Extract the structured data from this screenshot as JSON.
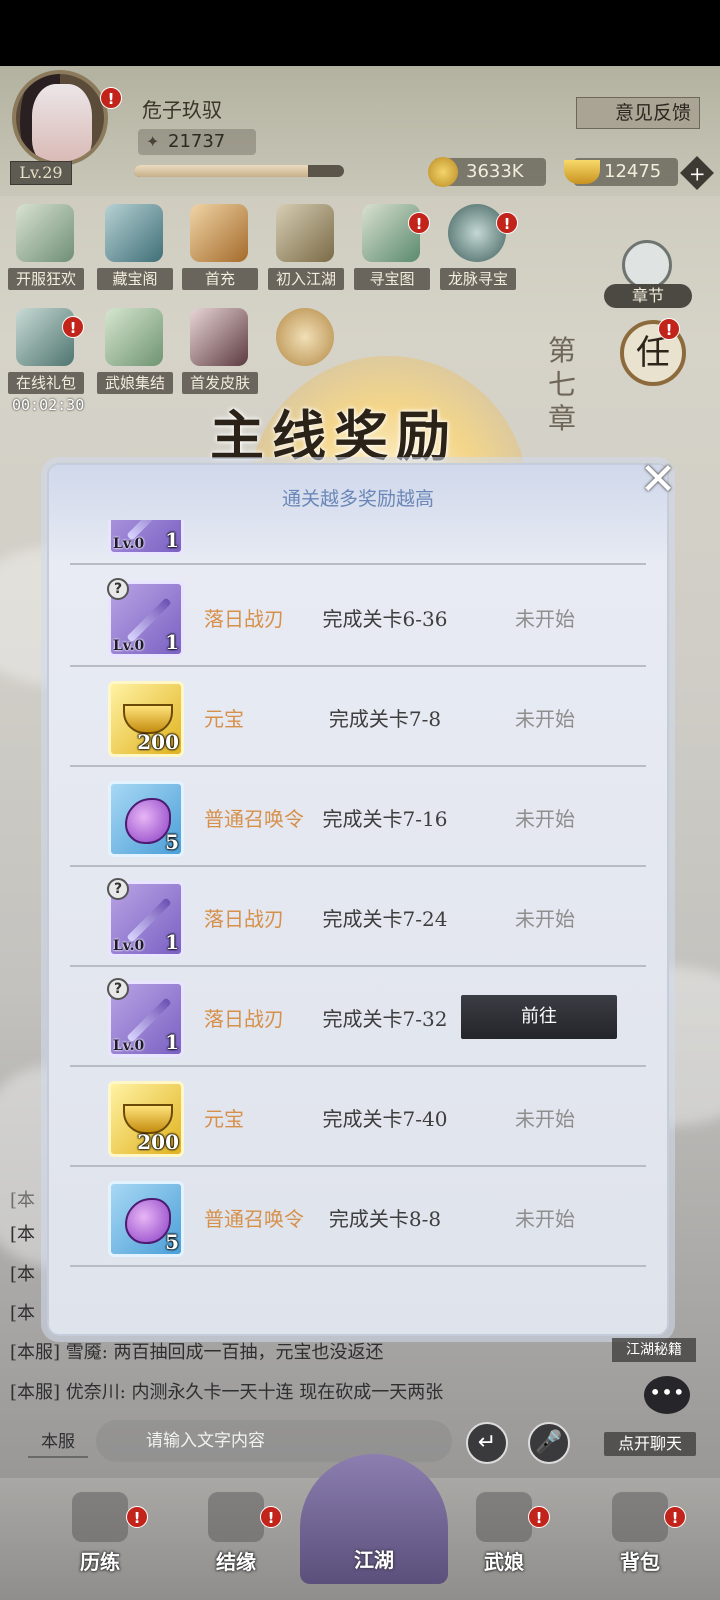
{
  "player": {
    "name": "危子玖驭",
    "level": "Lv.29",
    "power": "21737",
    "xp_fraction": 0.83
  },
  "header": {
    "feedback_label": "意见反馈",
    "gold": "3633K",
    "ingots": "12475",
    "plus": "+"
  },
  "activity_icons": [
    {
      "label": "开服狂欢",
      "badge": ""
    },
    {
      "label": "藏宝阁",
      "badge": ""
    },
    {
      "label": "首充",
      "badge": ""
    },
    {
      "label": "初入江湖",
      "badge": ""
    },
    {
      "label": "寻宝图",
      "badge": "!"
    },
    {
      "label": "龙脉寻宝",
      "badge": "!"
    },
    {
      "label": "在线礼包",
      "badge": "!"
    },
    {
      "label": "武娘集结",
      "badge": ""
    },
    {
      "label": "首发皮肤",
      "badge": ""
    }
  ],
  "online_timer": "00:02:30",
  "chapter": {
    "label": "章节",
    "side_text": "第七章"
  },
  "side_buttons": [
    {
      "glyph": "任"
    }
  ],
  "banner_title": "主线奖励",
  "modal": {
    "subtitle": "通关越多奖励越高",
    "close_glyph": "✕",
    "partial_row": {
      "lv": "Lv.0",
      "count": "1"
    },
    "rows": [
      {
        "item": "落日战刃",
        "type": "weapon",
        "lv": "Lv.0",
        "count": "1",
        "condition": "完成关卡6-36",
        "status": "未开始",
        "action": ""
      },
      {
        "item": "元宝",
        "type": "ingot",
        "lv": "",
        "count": "200",
        "condition": "完成关卡7-8",
        "status": "未开始",
        "action": ""
      },
      {
        "item": "普通召唤令",
        "type": "summon",
        "lv": "",
        "count": "5",
        "condition": "完成关卡7-16",
        "status": "未开始",
        "action": ""
      },
      {
        "item": "落日战刃",
        "type": "weapon",
        "lv": "Lv.0",
        "count": "1",
        "condition": "完成关卡7-24",
        "status": "未开始",
        "action": ""
      },
      {
        "item": "落日战刃",
        "type": "weapon",
        "lv": "Lv.0",
        "count": "1",
        "condition": "完成关卡7-32",
        "status": "",
        "action": "前往"
      },
      {
        "item": "元宝",
        "type": "ingot",
        "lv": "",
        "count": "200",
        "condition": "完成关卡7-40",
        "status": "未开始",
        "action": ""
      },
      {
        "item": "普通召唤令",
        "type": "summon",
        "lv": "",
        "count": "5",
        "condition": "完成关卡8-8",
        "status": "未开始",
        "action": ""
      }
    ]
  },
  "chat": {
    "partial_prefixes": [
      "[本",
      "[本",
      "[本",
      "[本"
    ],
    "messages": [
      "[本服] 雪魇: 两百抽回成一百抽，元宝也没返还",
      "[本服] 优奈川: 内测永久卡一天十连  现在砍成一天两张"
    ],
    "tab": "本服",
    "input_placeholder": "请输入文字内容",
    "enter_glyph": "↵",
    "mic_glyph": "🎤",
    "open_chat": "点开聊天",
    "bubble_glyph": "•••",
    "secret_label": "江湖秘籍"
  },
  "bottom_nav": [
    {
      "label": "历练",
      "badge": "!"
    },
    {
      "label": "结缘",
      "badge": "!"
    },
    {
      "label": "江湖",
      "badge": ""
    },
    {
      "label": "武娘",
      "badge": "!"
    },
    {
      "label": "背包",
      "badge": "!"
    }
  ],
  "badge_glyph": "!"
}
